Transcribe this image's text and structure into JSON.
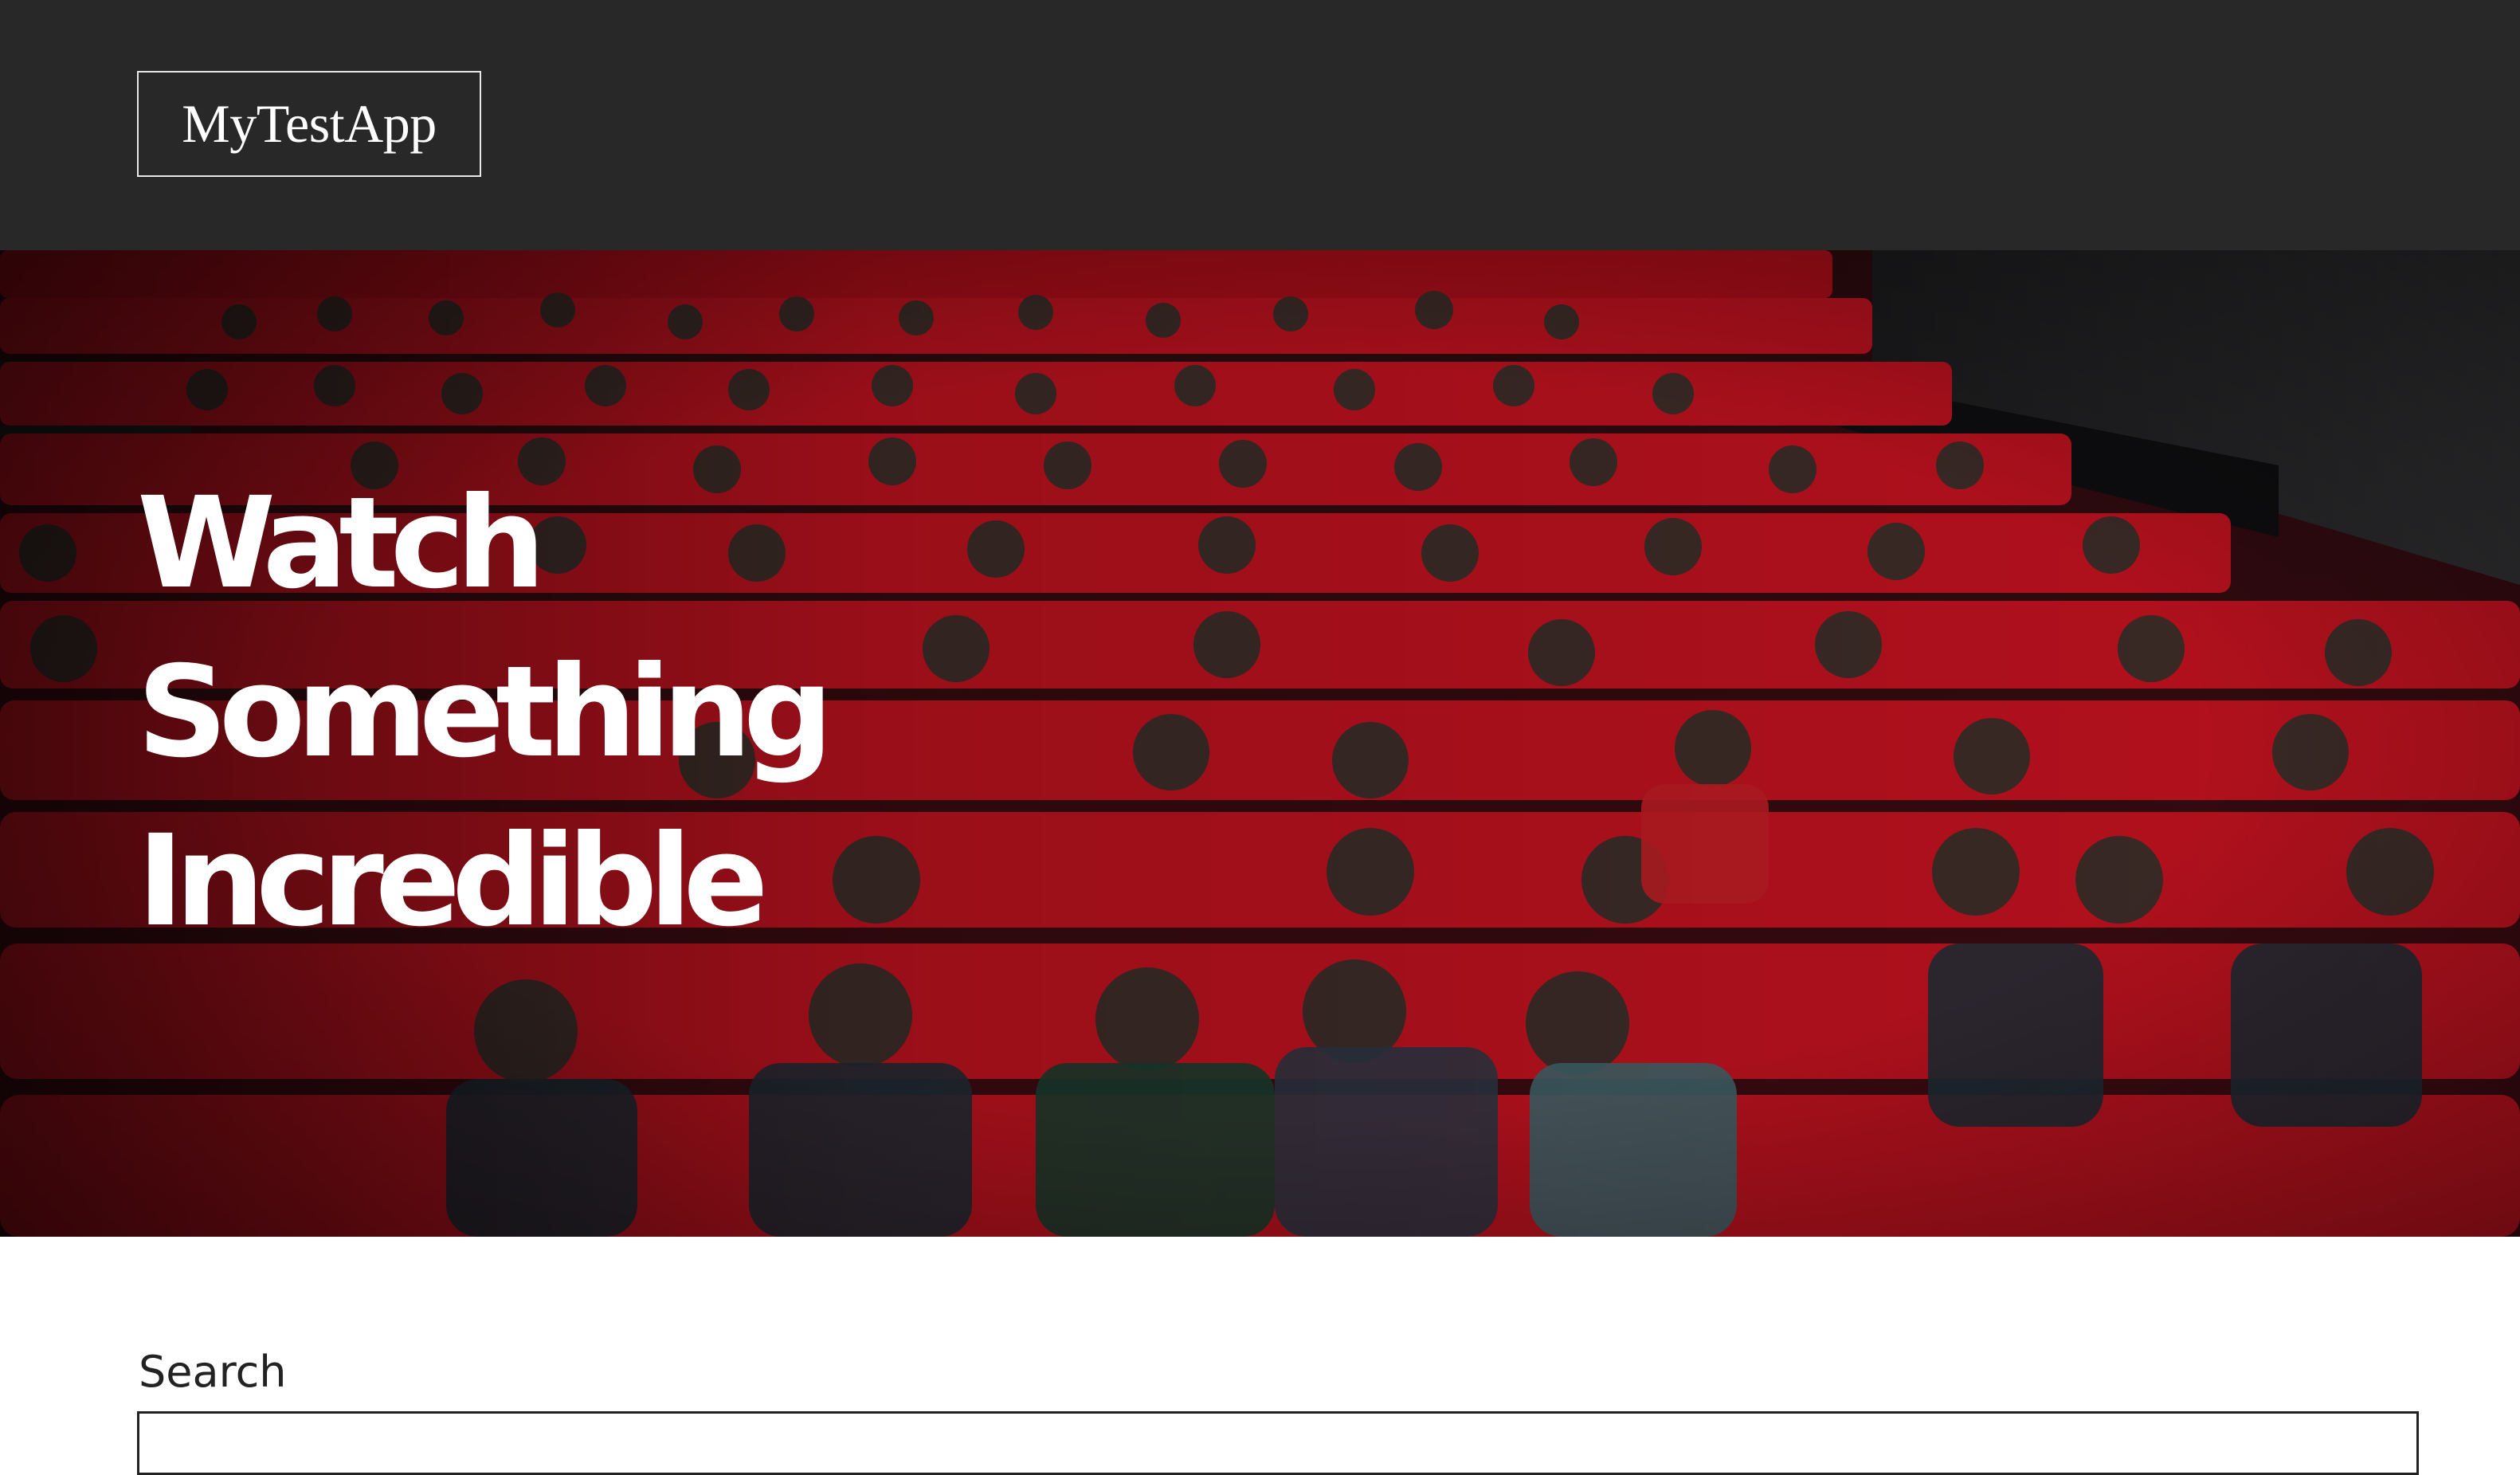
{
  "header": {
    "logo_text": "MyTestApp",
    "background": "#282828"
  },
  "hero": {
    "title_lines": [
      "Watch",
      "Something",
      "Incredible"
    ],
    "image_description_icon": "cinema-audience-photo",
    "seat_color": "#b0101c"
  },
  "search": {
    "label": "Search",
    "value": "",
    "placeholder": ""
  }
}
